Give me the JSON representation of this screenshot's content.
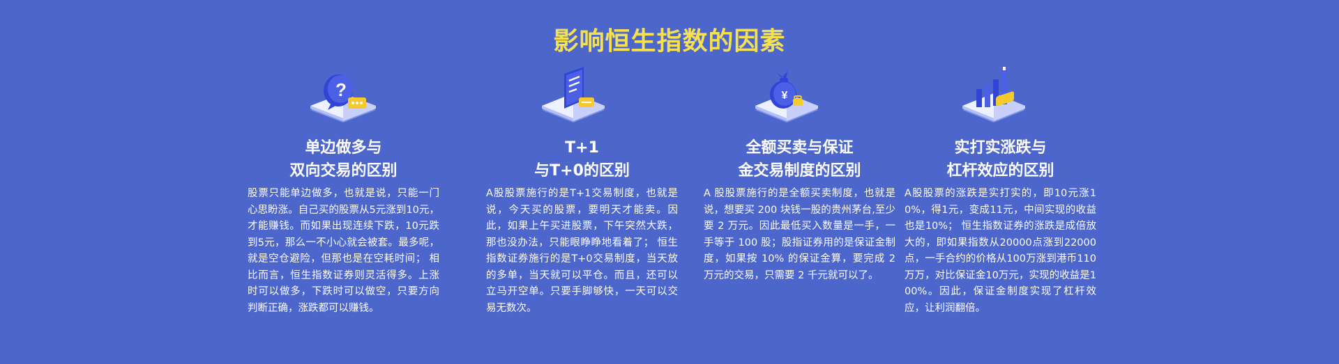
{
  "page": {
    "title": "影响恒生指数的因素"
  },
  "colors": {
    "background": "#4d66cc",
    "title": "#f5e04f",
    "text": "#ffffff",
    "icon_accent": "#f6c92d",
    "icon_primary": "#3045d6"
  },
  "factors": [
    {
      "icon": "question-bubble-icon",
      "heading_line1": "单边做多与",
      "heading_line2": "双向交易的区别",
      "body": "股票只能单边做多，也就是说，只能一门心思盼涨。自己买的股票从5元涨到10元，才能赚钱。而如果出现连续下跌，10元跌到5元，那么一不小心就会被套。最多呢，就是空仓避险，但那也是在空耗时间； 相比而言，恒生指数证券则灵活得多。上涨时可以做多，下跌时可以做空，只要方向判断正确，涨跌都可以赚钱。"
    },
    {
      "icon": "document-chat-icon",
      "heading_line1": "T+1",
      "heading_line2": "与T+0的区别",
      "body": "A股股票施行的是T+1交易制度，也就是说，今天买的股票，要明天才能卖。因此，如果上午买进股票，下午突然大跌，那也没办法，只能眼睁睁地看着了； 恒生指数证券施行的是T+0交易制度，当天放的多单，当天就可以平仓。而且，还可以立马开空单。只要手脚够快，一天可以交易无数次。"
    },
    {
      "icon": "money-bag-icon",
      "heading_line1": "全额买卖与保证",
      "heading_line2": "金交易制度的区别",
      "body": "A 股股票施行的是全额买卖制度，也就是说，想要买 200 块钱一股的贵州茅台,至少要 2 万元。因此最低买入数量是一手，一手等于 100 股；股指证券用的是保证金制度，如果按 10% 的保证金算，要完成 2 万元的交易，只需要 2 千元就可以了。"
    },
    {
      "icon": "bar-chart-icon",
      "heading_line1": "实打实涨跌与",
      "heading_line2": "杠杆效应的区别",
      "body": "A股股票的涨跌是实打实的，即10元涨10%，得1元，变成11元，中间实现的收益也是10%； 恒生指数证券的涨跌是成倍放大的，即如果指数从20000点涨到22000点，一手合约的价格从100万涨到港币110万万，对比保证金10万元，实现的收益是100%。因此，保证金制度实现了杠杆效应，让利润翻倍。"
    }
  ]
}
